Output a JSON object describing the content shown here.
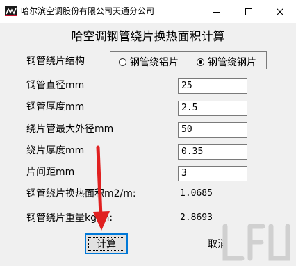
{
  "window": {
    "title": "哈尔滨空调股份有限公司天通分公司",
    "icon": "app-logo-icon"
  },
  "controls": {
    "minimize_icon": "minimize-icon",
    "maximize_icon": "maximize-icon",
    "close_icon": "close-icon"
  },
  "heading": "哈空调钢管绕片换热面积计算",
  "structure": {
    "label": "钢管绕片结构",
    "options": [
      {
        "label": "钢管绕铝片",
        "selected": false
      },
      {
        "label": "钢管绕钢片",
        "selected": true
      }
    ]
  },
  "fields": [
    {
      "label": "钢管直径mm",
      "value": "25"
    },
    {
      "label": "钢管厚度mm",
      "value": "2.5"
    },
    {
      "label": "绕片管最大外径mm",
      "value": "50"
    },
    {
      "label": "绕片厚度mm",
      "value": "0.35"
    },
    {
      "label": "片间距mm",
      "value": "3"
    }
  ],
  "results": [
    {
      "label": "钢管绕片换热面积m2/m:",
      "value": "1.0685"
    },
    {
      "label": "钢管绕片重量kg/m:",
      "value": "2.8693"
    }
  ],
  "buttons": {
    "calculate": "计算",
    "cancel": "取消"
  },
  "colors": {
    "focus_border": "#0078d7",
    "arrow": "#e02020",
    "watermark": "#d0d0d0"
  }
}
